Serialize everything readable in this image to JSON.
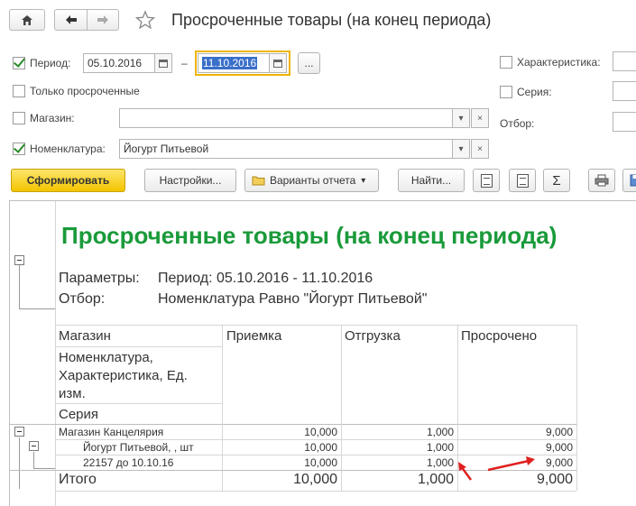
{
  "window": {
    "title": "Просроченные товары (на конец периода)"
  },
  "filters": {
    "period_label": "Период:",
    "period_from": "05.10.2016",
    "period_dash": "–",
    "period_to": "11.10.2016",
    "period_more": "...",
    "only_overdue_label": "Только просроченные",
    "store_label": "Магазин:",
    "store_value": "",
    "item_label": "Номенклатура:",
    "item_value": "Йогурт Питьевой",
    "characteristic_label": "Характеристика:",
    "series_label": "Серия:",
    "selection_label": "Отбор:"
  },
  "toolbar": {
    "generate": "Сформировать",
    "settings": "Настройки...",
    "variants": "Варианты отчета",
    "find": "Найти...",
    "sum": "Σ"
  },
  "report": {
    "title": "Просроченные товары (на конец периода)",
    "params_label": "Параметры:",
    "params_value": "Период: 05.10.2016 - 11.10.2016",
    "selection_label": "Отбор:",
    "selection_value": "Номенклатура Равно \"Йогурт Питьевой\"",
    "headers": {
      "store": "Магазин",
      "item_line1": "Номенклатура,",
      "item_line2": "Характеристика, Ед.",
      "item_line3": "изм.",
      "series": "Серия",
      "receipt": "Приемка",
      "shipment": "Отгрузка",
      "overdue": "Просрочено"
    },
    "rows": [
      {
        "name": "Магазин Канцелярия",
        "receipt": "10,000",
        "shipment": "1,000",
        "overdue": "9,000"
      },
      {
        "name": "Йогурт Питьевой, , шт",
        "receipt": "10,000",
        "shipment": "1,000",
        "overdue": "9,000"
      },
      {
        "name": "22157 до 10.10.16",
        "receipt": "10,000",
        "shipment": "1,000",
        "overdue": "9,000"
      }
    ],
    "total": {
      "name": "Итого",
      "receipt": "10,000",
      "shipment": "1,000",
      "overdue": "9,000"
    }
  },
  "colors": {
    "report_title": "#1a9a3a",
    "primary_button": "#f4c400",
    "active_field_border": "#f0b400",
    "selection_highlight": "#3a6fc9",
    "annotation_arrow": "#e02020"
  }
}
